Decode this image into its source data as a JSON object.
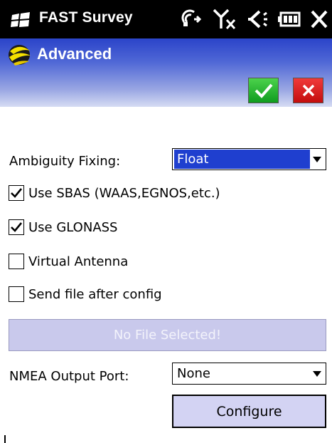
{
  "status_bar": {
    "app_name": "FAST Survey",
    "icons": [
      "windows-flag-icon",
      "connectivity-icon",
      "signal-off-icon",
      "speaker-icon",
      "battery-icon",
      "close-icon"
    ]
  },
  "header": {
    "title": "Advanced",
    "logo_icon": "app-logo-icon",
    "ok_icon": "checkmark-icon",
    "cancel_icon": "x-icon",
    "colors": {
      "header_top": "#2b44c9",
      "ok": "#1ca82a",
      "cancel": "#e01e1e"
    }
  },
  "form": {
    "ambiguity_label": "Ambiguity Fixing:",
    "ambiguity_value": "Float",
    "options": [
      {
        "label": "Use SBAS (WAAS,EGNOS,etc.)",
        "checked": true
      },
      {
        "label": "Use GLONASS",
        "checked": true
      },
      {
        "label": "Virtual Antenna",
        "checked": false
      },
      {
        "label": "Send file after config",
        "checked": false
      }
    ],
    "file_button": "No File Selected!",
    "nmea_label": "NMEA Output Port:",
    "nmea_value": "None",
    "configure_button": "Configure",
    "colors": {
      "selection": "#1f3fcf",
      "button_bg": "#d3d3f3",
      "disabled_bg": "#c9c9ec"
    }
  }
}
